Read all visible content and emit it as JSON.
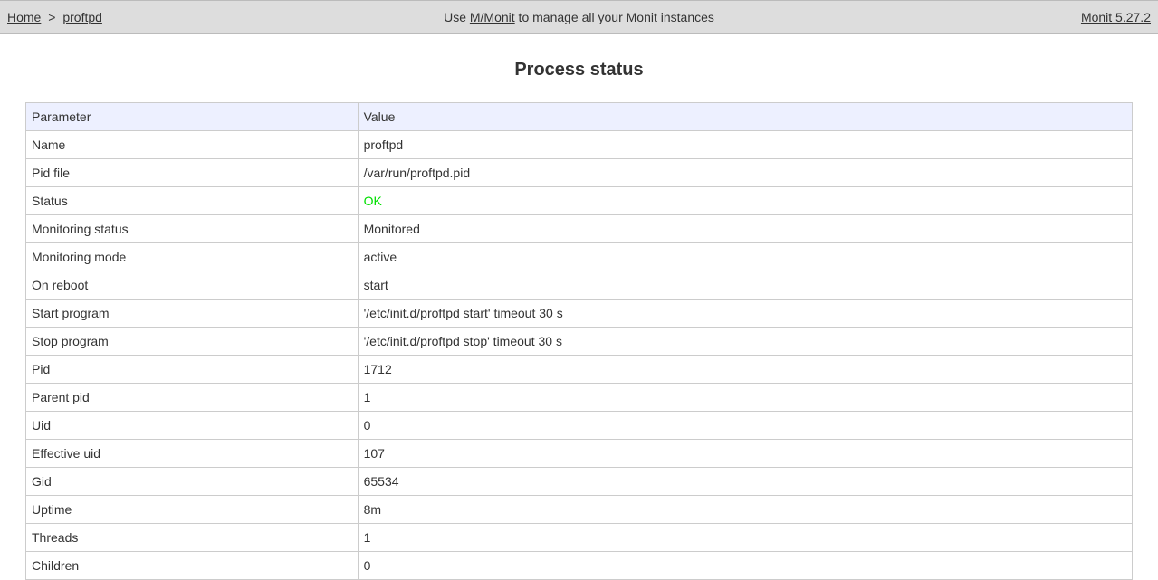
{
  "header": {
    "home_link": "Home",
    "breadcrumb_sep": ">",
    "current": "proftpd",
    "center_prefix": "Use ",
    "mmonit_link": "M/Monit",
    "center_suffix": " to manage all your Monit instances",
    "version_link": "Monit 5.27.2"
  },
  "page_title": "Process status",
  "table": {
    "headers": {
      "param": "Parameter",
      "value": "Value"
    },
    "rows": [
      {
        "param": "Name",
        "value": "proftpd"
      },
      {
        "param": "Pid file",
        "value": "/var/run/proftpd.pid"
      },
      {
        "param": "Status",
        "value": "OK",
        "status_ok": true
      },
      {
        "param": "Monitoring status",
        "value": "Monitored"
      },
      {
        "param": "Monitoring mode",
        "value": "active"
      },
      {
        "param": "On reboot",
        "value": "start"
      },
      {
        "param": "Start program",
        "value": "'/etc/init.d/proftpd start' timeout 30 s"
      },
      {
        "param": "Stop program",
        "value": "'/etc/init.d/proftpd stop' timeout 30 s"
      },
      {
        "param": "Pid",
        "value": "1712"
      },
      {
        "param": "Parent pid",
        "value": "1"
      },
      {
        "param": "Uid",
        "value": "0"
      },
      {
        "param": "Effective uid",
        "value": "107"
      },
      {
        "param": "Gid",
        "value": "65534"
      },
      {
        "param": "Uptime",
        "value": "8m"
      },
      {
        "param": "Threads",
        "value": "1"
      },
      {
        "param": "Children",
        "value": "0"
      }
    ]
  }
}
